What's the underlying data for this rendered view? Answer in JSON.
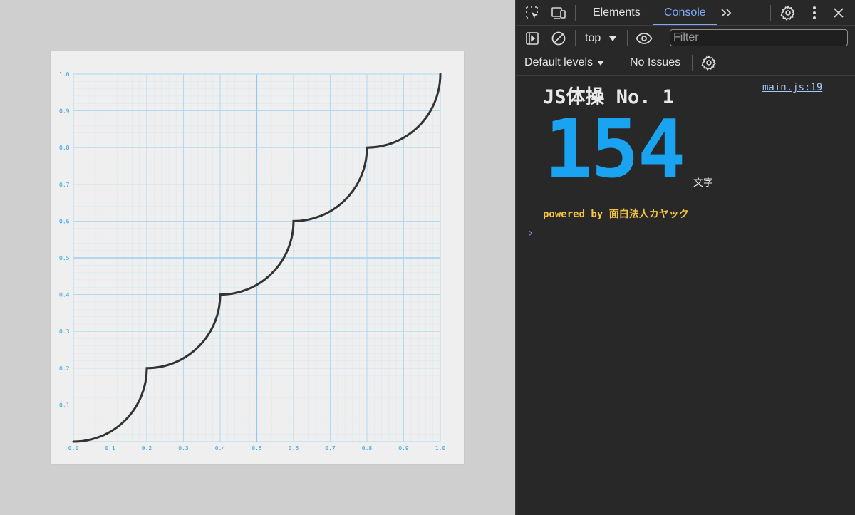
{
  "devtools": {
    "tabs": [
      {
        "label": "Elements",
        "active": false
      },
      {
        "label": "Console",
        "active": true
      }
    ],
    "more_tabs_glyph": ">>",
    "context": "top",
    "filter_placeholder": "Filter",
    "levels_label": "Default levels",
    "issues_label": "No Issues",
    "accent_color": "#7cacf8"
  },
  "console": {
    "title": "JS体操 No. 1",
    "source": "main.js:19",
    "char_count": "154",
    "char_unit": "文字",
    "powered_by": "powered by 面白法人カヤック",
    "prompt_glyph": "›",
    "count_color": "#1aa3f0",
    "powered_color": "#f5c542"
  },
  "chart_data": {
    "type": "line",
    "title": "",
    "xlabel": "",
    "ylabel": "",
    "xlim": [
      0.0,
      1.0
    ],
    "ylim": [
      0.0,
      1.0
    ],
    "grid": true,
    "x_ticks": [
      "0.0",
      "0.1",
      "0.2",
      "0.3",
      "0.4",
      "0.5",
      "0.6",
      "0.7",
      "0.8",
      "0.9",
      "1.0"
    ],
    "y_ticks": [
      "0.1",
      "0.2",
      "0.3",
      "0.4",
      "0.5",
      "0.6",
      "0.7",
      "0.8",
      "0.9",
      "1.0"
    ],
    "series": [
      {
        "color": "#333333",
        "segments": 5,
        "description_points": [
          [
            0,
            0
          ],
          [
            0.2,
            0.2
          ],
          [
            0.4,
            0.4
          ],
          [
            0.6,
            0.6
          ],
          [
            0.8,
            0.8
          ],
          [
            1.0,
            1.0
          ]
        ],
        "shape": "quarter-circle arcs, center at top-left of each 0.2 step"
      }
    ],
    "grid_color": "#a9d8f2",
    "tick_color": "#22a3e6"
  }
}
